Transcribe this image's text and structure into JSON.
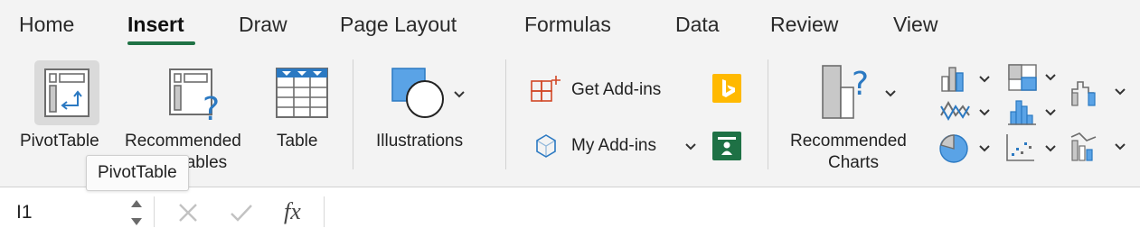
{
  "tabs": [
    {
      "label": "Home"
    },
    {
      "label": "Insert"
    },
    {
      "label": "Draw"
    },
    {
      "label": "Page Layout"
    },
    {
      "label": "Formulas"
    },
    {
      "label": "Data"
    },
    {
      "label": "Review"
    },
    {
      "label": "View"
    }
  ],
  "active_tab": "Insert",
  "ribbon": {
    "pivottable_label": "PivotTable",
    "recommended_pivottables_line1": "Recommended",
    "recommended_pivottables_line2": "PivotTables",
    "table_label": "Table",
    "illustrations_label": "Illustrations",
    "get_addins_label": "Get Add-ins",
    "my_addins_label": "My Add-ins",
    "recommended_charts_line1": "Recommended",
    "recommended_charts_line2": "Charts"
  },
  "tooltip": "PivotTable",
  "formula_bar": {
    "name_box_value": "I1",
    "cancel_icon": "x-icon",
    "enter_icon": "check-icon",
    "fx_label": "fx",
    "formula_value": ""
  },
  "colors": {
    "accent": "#1f7245",
    "addin_orange": "#d24726",
    "bing_yellow": "#ffb900",
    "people_green": "#1e7145",
    "chart_blue": "#5aa3e6"
  }
}
